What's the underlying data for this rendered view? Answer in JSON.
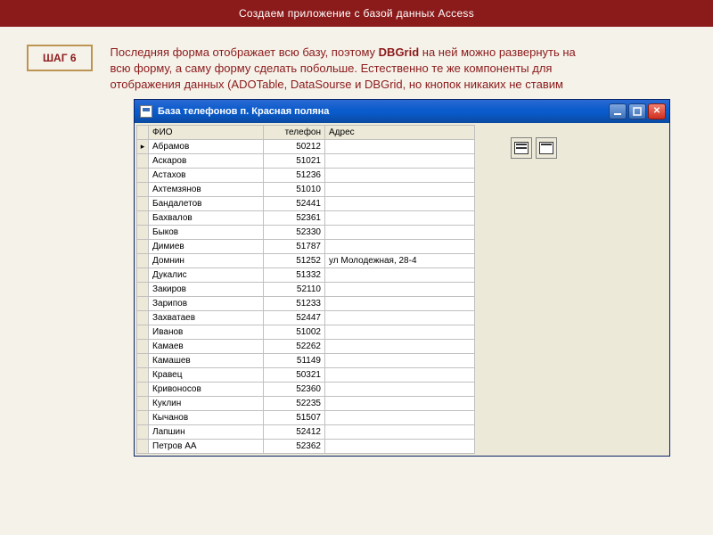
{
  "header": {
    "title": "Создаем приложение с базой данных Access"
  },
  "step": {
    "label": "ШАГ 6"
  },
  "paragraph": {
    "part1": "Последняя форма отображает всю базу, поэтому ",
    "bold1": "DBGrid",
    "part2": " на ней можно развернуть на всю форму, а саму форму сделать побольше. Естественно те же компоненты для отображения данных (ADOTable, DataSourse и DBGrid, но кнопок никаких не ставим"
  },
  "window": {
    "title": "База телефонов п. Красная поляна",
    "columns": {
      "fio": "ФИО",
      "tel": "телефон",
      "adr": "Адрес"
    },
    "rows": [
      {
        "fio": "Абрамов",
        "tel": "50212",
        "adr": ""
      },
      {
        "fio": "Аскаров",
        "tel": "51021",
        "adr": ""
      },
      {
        "fio": "Астахов",
        "tel": "51236",
        "adr": ""
      },
      {
        "fio": "Ахтемзянов",
        "tel": "51010",
        "adr": ""
      },
      {
        "fio": "Бандалетов",
        "tel": "52441",
        "adr": ""
      },
      {
        "fio": "Бахвалов",
        "tel": "52361",
        "adr": ""
      },
      {
        "fio": "Быков",
        "tel": "52330",
        "adr": ""
      },
      {
        "fio": "Димиев",
        "tel": "51787",
        "adr": ""
      },
      {
        "fio": "Домнин",
        "tel": "51252",
        "adr": "ул Молодежная, 28-4"
      },
      {
        "fio": "Дукалис",
        "tel": "51332",
        "adr": ""
      },
      {
        "fio": "Закиров",
        "tel": "52110",
        "adr": ""
      },
      {
        "fio": "Зарипов",
        "tel": "51233",
        "adr": ""
      },
      {
        "fio": "Захватаев",
        "tel": "52447",
        "adr": ""
      },
      {
        "fio": "Иванов",
        "tel": "51002",
        "adr": ""
      },
      {
        "fio": "Камаев",
        "tel": "52262",
        "adr": ""
      },
      {
        "fio": "Камашев",
        "tel": "51149",
        "adr": ""
      },
      {
        "fio": "Кравец",
        "tel": "50321",
        "adr": ""
      },
      {
        "fio": "Кривоносов",
        "tel": "52360",
        "adr": ""
      },
      {
        "fio": "Куклин",
        "tel": "52235",
        "adr": ""
      },
      {
        "fio": "Кычанов",
        "tel": "51507",
        "adr": ""
      },
      {
        "fio": "Лапшин",
        "tel": "52412",
        "adr": ""
      },
      {
        "fio": "Петров АА",
        "tel": "52362",
        "adr": ""
      }
    ],
    "components": {
      "a": "adotable-icon",
      "b": "datasource-icon"
    }
  }
}
